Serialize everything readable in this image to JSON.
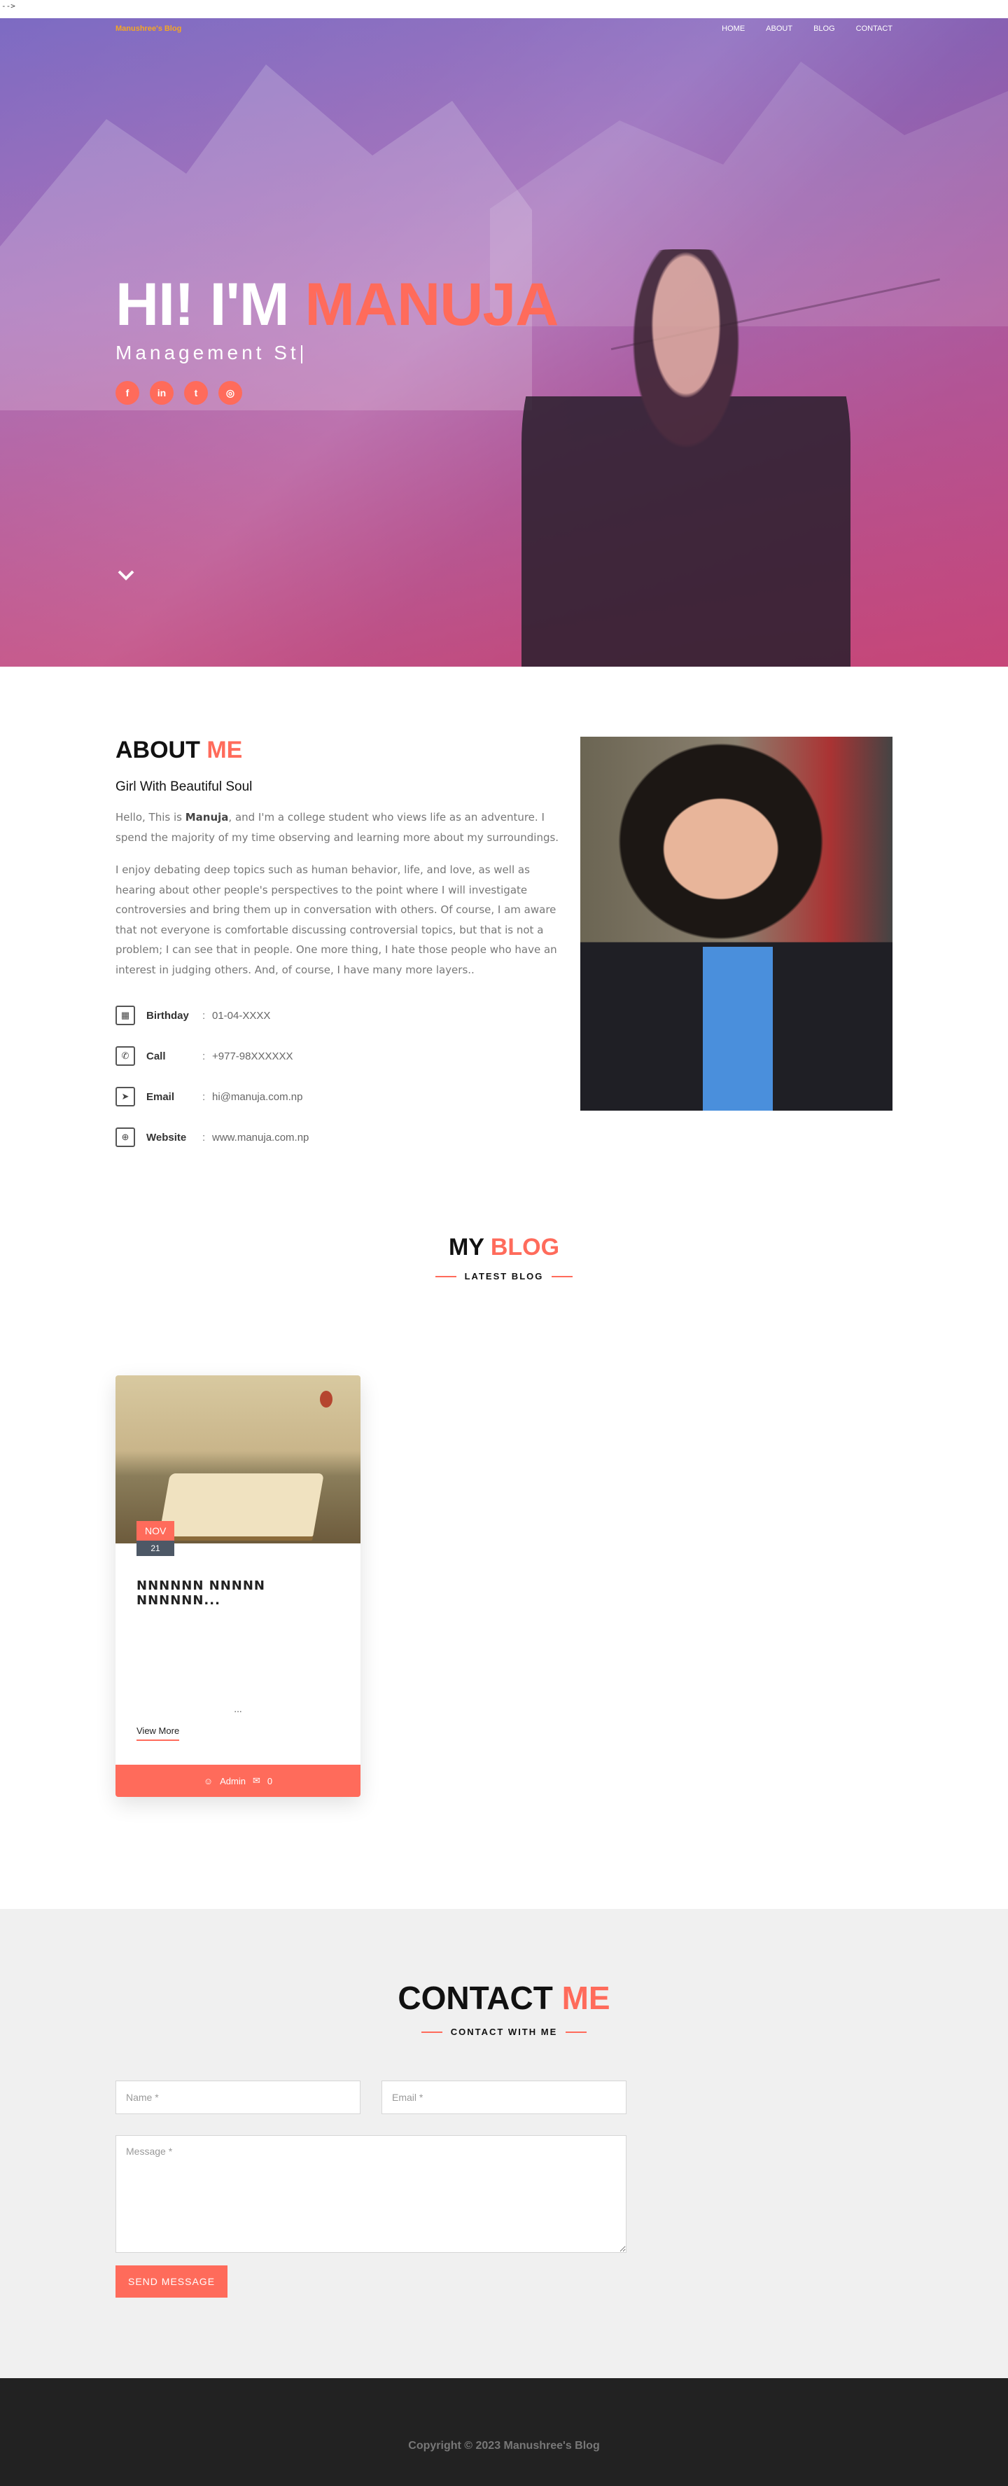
{
  "stray_text": "-->",
  "nav": {
    "brand": "Manushree's Blog",
    "links": [
      "HOME",
      "ABOUT",
      "BLOG",
      "CONTACT"
    ]
  },
  "hero": {
    "title_prefix": "HI! I'M ",
    "title_accent": "MANUJA",
    "subtitle": "Management St",
    "socials": [
      {
        "icon": "facebook-icon",
        "glyph": "f"
      },
      {
        "icon": "linkedin-icon",
        "glyph": "in"
      },
      {
        "icon": "twitter-icon",
        "glyph": "t"
      },
      {
        "icon": "instagram-icon",
        "glyph": "◎"
      }
    ]
  },
  "about": {
    "heading": "ABOUT",
    "heading_accent": "ME",
    "subheading": "Girl With Beautiful Soul",
    "p1_before": "Hello, This is ",
    "p1_bold": "Manuja",
    "p1_after": ", and I'm a college student who views life as an adventure. I spend the majority of my time observing and learning more about my surroundings.",
    "p2": "I enjoy debating deep topics such as human behavior, life, and love, as well as hearing about other people's perspectives to the point where I will investigate controversies and bring them up in conversation with others. Of course, I am aware that not everyone is comfortable discussing controversial topics, but that is not a problem; I can see that in people. One more thing, I hate those people who have an interest in judging others. And, of course, I have many more layers..",
    "info": [
      {
        "icon": "calendar-icon",
        "glyph": "▦",
        "label": "Birthday",
        "value": "01-04-XXXX"
      },
      {
        "icon": "phone-icon",
        "glyph": "✆",
        "label": "Call",
        "value": "+977-98XXXXXX"
      },
      {
        "icon": "send-icon",
        "glyph": "➤",
        "label": "Email",
        "value": "hi@manuja.com.np"
      },
      {
        "icon": "globe-icon",
        "glyph": "⊕",
        "label": "Website",
        "value": "www.manuja.com.np"
      }
    ],
    "separator": ":"
  },
  "blog": {
    "heading": "MY",
    "heading_accent": "BLOG",
    "sub": "LATEST BLOG",
    "card": {
      "month": "NOV",
      "day": "21",
      "title": "ΝΝΝΝΝΝ ΝΝΝΝΝ ΝΝΝΝΝΝ...",
      "ellipsis": "...",
      "more": "View More",
      "author": "Admin",
      "comments": "0"
    }
  },
  "contact": {
    "heading": "CONTACT",
    "heading_accent": "ME",
    "sub": "CONTACT WITH ME",
    "name_placeholder": "Name *",
    "email_placeholder": "Email *",
    "message_placeholder": "Message *",
    "send": "SEND MESSAGE"
  },
  "footer": {
    "copyright": "Copyright © 2023 Manushree's Blog"
  },
  "colors": {
    "accent": "#ff6b5b",
    "brand": "#f5a623",
    "footer_bg": "#222222",
    "contact_bg": "#f0f0f0"
  }
}
